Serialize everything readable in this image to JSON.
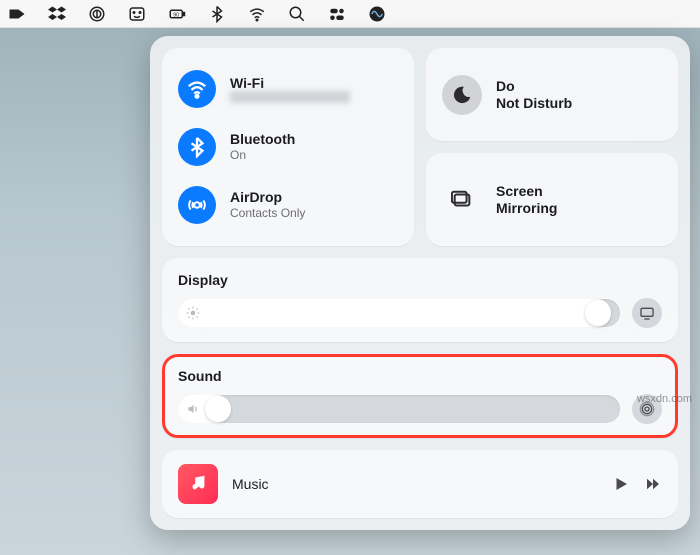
{
  "menubar": {
    "icons": [
      "launcher-icon",
      "dropbox-icon",
      "onepassword-icon",
      "finder-icon",
      "battery-icon",
      "bluetooth-icon",
      "wifi-icon",
      "search-icon",
      "controlcenter-icon",
      "siri-icon"
    ]
  },
  "controlCenter": {
    "network": {
      "wifi_title": "Wi-Fi",
      "wifi_subtitle": "",
      "bluetooth_title": "Bluetooth",
      "bluetooth_subtitle": "On",
      "airdrop_title": "AirDrop",
      "airdrop_subtitle": "Contacts Only"
    },
    "dnd": {
      "title": "Do Not Disturb"
    },
    "screenMirroring": {
      "title": "Screen Mirroring"
    },
    "display": {
      "title": "Display",
      "brightness_percent": 98
    },
    "sound": {
      "title": "Sound",
      "volume_percent": 12
    },
    "music": {
      "title": "Music"
    }
  },
  "highlighted_section": "sound",
  "watermark": "wsxdn.com"
}
